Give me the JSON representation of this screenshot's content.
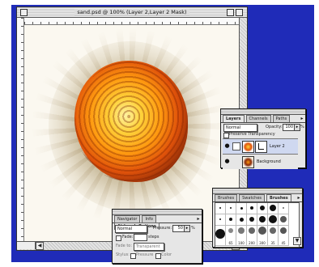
{
  "document": {
    "title": "sand.psd @ 100% (Layer 2,Layer 2 Mask)"
  },
  "layers_palette": {
    "tabs": [
      "Layers",
      "Channels",
      "Paths"
    ],
    "active_tab": "Layers",
    "blend_mode": "Normal",
    "opacity_label": "Opacity:",
    "opacity_value": "100",
    "opacity_unit": "%",
    "preserve_transparency_label": "Preserve Transparency",
    "layers": [
      {
        "name": "Layer 2",
        "selected": true
      },
      {
        "name": "Background",
        "selected": false
      }
    ]
  },
  "brushes_palette": {
    "tabs": [
      "Brushes",
      "Swatches",
      "Brushes"
    ],
    "active_tab": "Brushes",
    "brush_sizes": [
      "65",
      "100",
      "200",
      "300",
      "35",
      "45"
    ]
  },
  "airbrush_palette": {
    "tabs": [
      "Navigator",
      "Info",
      "Airbrush Options"
    ],
    "active_tab": "Airbrush Options",
    "mode": "Normal",
    "pressure_label": "Pressure:",
    "pressure_value": "50",
    "pressure_unit": "%",
    "fade_label": "Fade:",
    "fade_value": "",
    "fade_unit": "steps",
    "fade_to_label": "Fade to:",
    "fade_to_value": "Transparent",
    "stylus_label": "Stylus:",
    "stylus_options": [
      "Pressure",
      "Color"
    ]
  },
  "colors": {
    "desktop": "#1f2bb8",
    "fire_core": "#ffd23a",
    "fire_edge": "#8a2a08",
    "selection": "#cfd8f0"
  }
}
